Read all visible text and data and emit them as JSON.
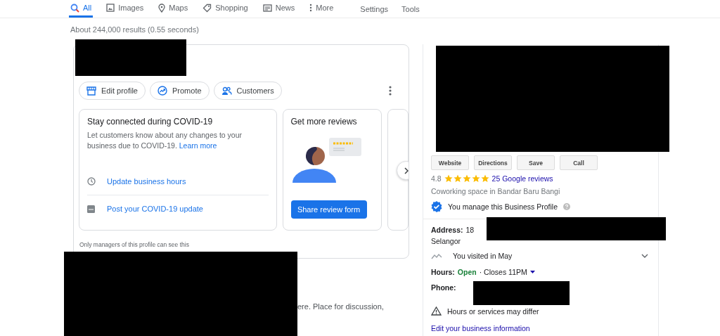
{
  "nav": {
    "tabs": [
      {
        "label": "All",
        "selected": true
      },
      {
        "label": "Images",
        "selected": false
      },
      {
        "label": "Maps",
        "selected": false
      },
      {
        "label": "Shopping",
        "selected": false
      },
      {
        "label": "News",
        "selected": false
      },
      {
        "label": "More",
        "selected": false
      }
    ],
    "links": [
      "Settings",
      "Tools"
    ]
  },
  "result_stats": "About 244,000 results (0.55 seconds)",
  "profile_card": {
    "actions": [
      {
        "label": "Edit profile"
      },
      {
        "label": "Promote"
      },
      {
        "label": "Customers"
      }
    ],
    "covid_card": {
      "title": "Stay connected during COVID-19",
      "text": "Let customers know about any changes to your business due to COVID-19.",
      "link": "Learn more",
      "tasks": [
        {
          "label": "Update business hours"
        },
        {
          "label": "Post your COVID-19 update"
        }
      ]
    },
    "reviews_card": {
      "title": "Get more reviews",
      "button": "Share review form"
    },
    "note": "Only managers of this profile can see this"
  },
  "snippet": "ere. Place for discussion,",
  "knowledge_panel": {
    "buttons": [
      "Website",
      "Directions",
      "Save",
      "Call"
    ],
    "rating": "4.8",
    "stars": 5,
    "reviews_link": "25 Google reviews",
    "category": "Coworking space in Bandar Baru Bangi",
    "managed": "You manage this Business Profile",
    "address_label": "Address:",
    "address_value": "18",
    "address_line2": "Selangor",
    "visited": "You visited in May",
    "hours_label": "Hours:",
    "hours_status": "Open",
    "hours_detail": "· Closes 11PM",
    "phone_label": "Phone:",
    "notice": "Hours or services may differ",
    "edit_link": "Edit your business information"
  }
}
